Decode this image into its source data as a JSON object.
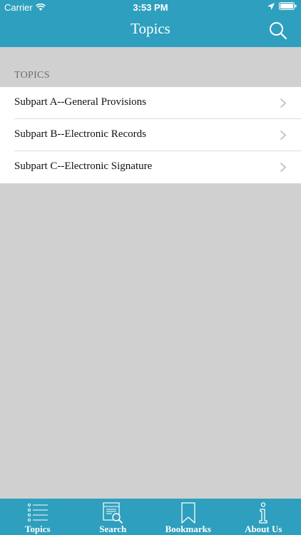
{
  "status_bar": {
    "carrier": "Carrier",
    "time": "3:53 PM"
  },
  "nav": {
    "title": "Topics",
    "search_icon": "search-icon"
  },
  "section": {
    "header": "TOPICS"
  },
  "topics": [
    {
      "label": "Subpart A--General Provisions"
    },
    {
      "label": "Subpart B--Electronic Records"
    },
    {
      "label": "Subpart C--Electronic Signature"
    }
  ],
  "tabs": [
    {
      "label": "Topics",
      "icon": "list-icon"
    },
    {
      "label": "Search",
      "icon": "search-document-icon"
    },
    {
      "label": "Bookmarks",
      "icon": "bookmark-icon"
    },
    {
      "label": "About Us",
      "icon": "info-icon"
    }
  ],
  "colors": {
    "accent": "#2e9fbe",
    "background": "#d0d0d0"
  }
}
